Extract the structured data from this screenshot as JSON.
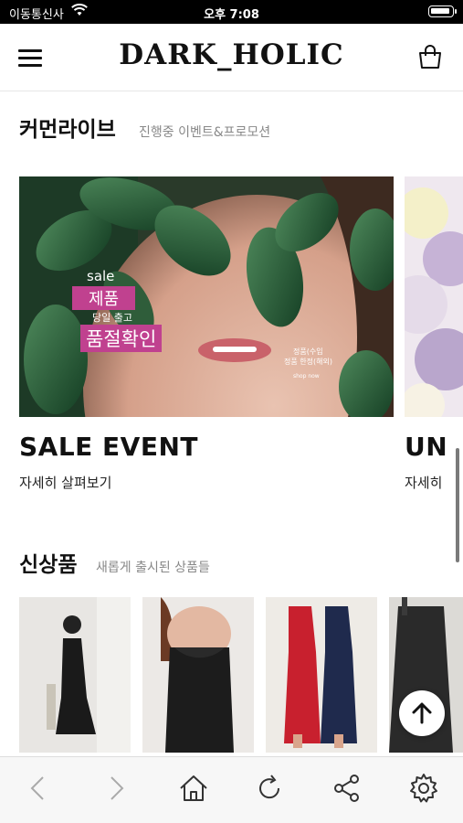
{
  "status_bar": {
    "carrier": "이동통신사",
    "time": "오후 7:08"
  },
  "header": {
    "logo": "DARK_HOLIC"
  },
  "sections": {
    "community": {
      "title": "커먼라이브",
      "subtitle": "진행중 이벤트&프로모션"
    },
    "new_arrivals": {
      "title": "신상품",
      "subtitle": "새롭게 출시된 상품들"
    }
  },
  "banners": [
    {
      "title": "SALE EVENT",
      "link": "자세히 살펴보기",
      "overlay": {
        "small": "sale",
        "line1": "제품",
        "line2": "당일 출고",
        "line3": "품절확인",
        "side1": "정품(수입",
        "side2": "정품 한정(해외)",
        "side3": "shop now"
      }
    },
    {
      "title": "UN",
      "link": "자세히"
    }
  ],
  "icons": {
    "menu": "hamburger-icon",
    "cart": "shopping-bag-icon",
    "back": "chevron-left-icon",
    "forward": "chevron-right-icon",
    "home": "home-icon",
    "refresh": "refresh-icon",
    "share": "share-icon",
    "settings": "gear-icon",
    "top": "arrow-up-icon"
  },
  "colors": {
    "accent_pink": "#c0418f",
    "text": "#111111",
    "muted": "#888888"
  }
}
